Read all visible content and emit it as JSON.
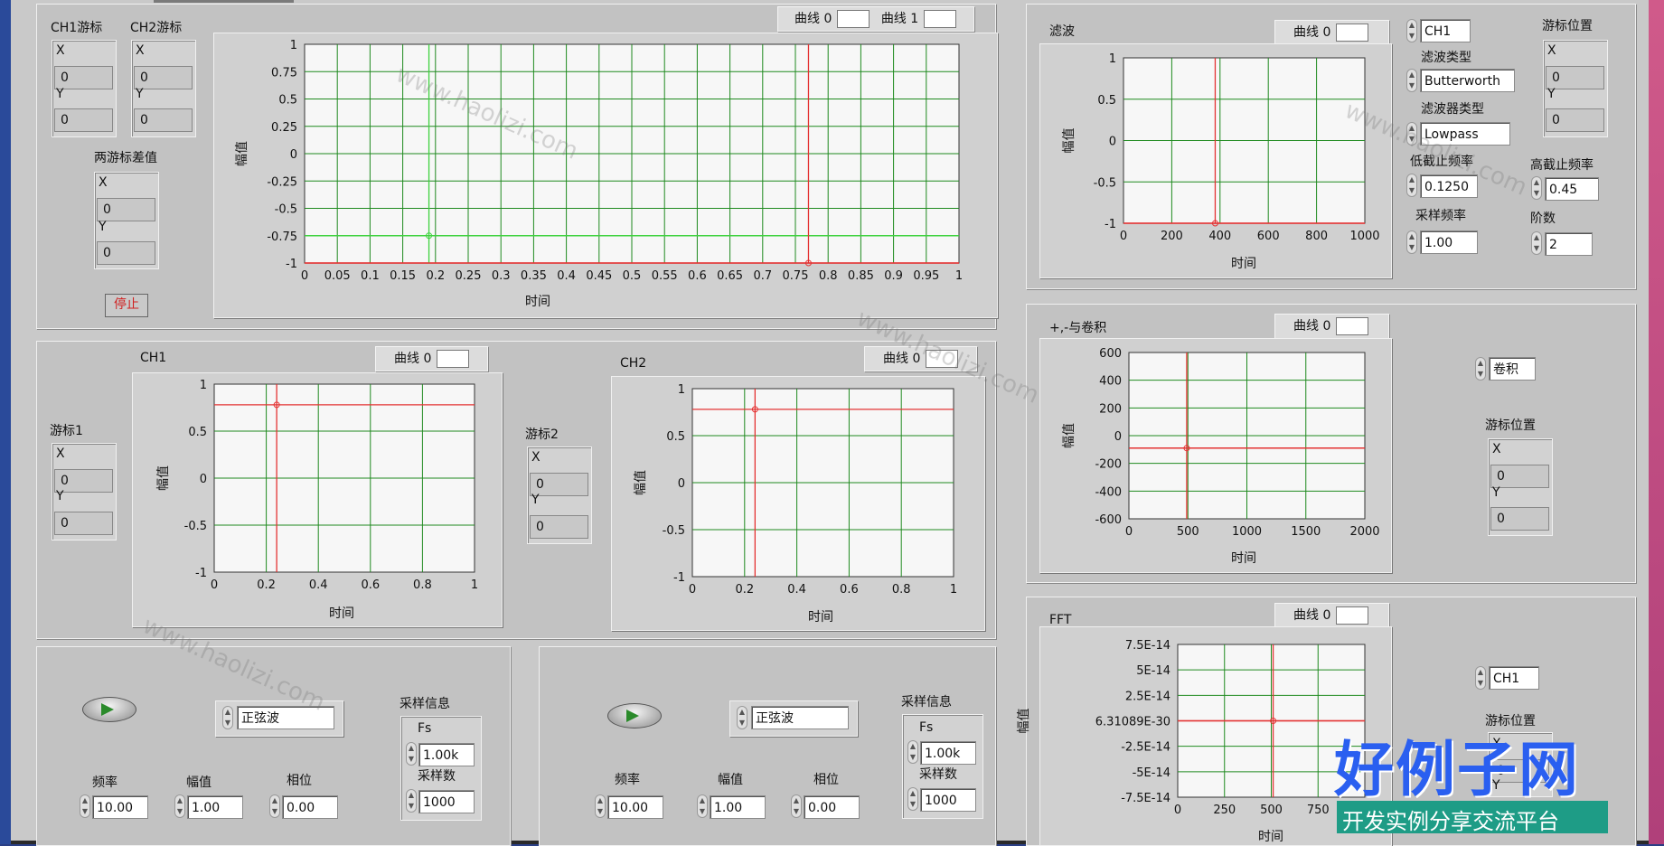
{
  "cursor_panel": {
    "ch1_cursor_label": "CH1游标",
    "ch2_cursor_label": "CH2游标",
    "diff_label": "两游标差值",
    "ch1": {
      "x_label": "X",
      "x": "0",
      "y_label": "Y",
      "y": "0"
    },
    "ch2": {
      "x_label": "X",
      "x": "0",
      "y_label": "Y",
      "y": "0"
    },
    "diff": {
      "x_label": "X",
      "x": "0",
      "y_label": "Y",
      "y": "0"
    },
    "stop_label": "停止"
  },
  "legends": {
    "curve0": "曲线 0",
    "curve1": "曲线 1"
  },
  "axis_text": {
    "amplitude": "幅值",
    "time": "时间"
  },
  "colors": {
    "grid": "#1f8a1f",
    "cursor_red": "#e43333",
    "cursor_green": "#3fd23f",
    "plot_bg": "#f7f7f7",
    "panel": "#c4c4c4",
    "chart_frame": "#d0d0d0",
    "accent_blue": "#2a5ff0",
    "dark_blue": "#2a3f86",
    "watermark_teal": "#1e9c86"
  },
  "ch1_ch2": {
    "ch1_title": "CH1",
    "ch2_title": "CH2",
    "cursor1_label": "游标1",
    "cursor2_label": "游标2",
    "cursor1": {
      "x_label": "X",
      "x": "0",
      "y_label": "Y",
      "y": "0"
    },
    "cursor2": {
      "x_label": "X",
      "x": "0",
      "y_label": "Y",
      "y": "0"
    }
  },
  "gen1": {
    "wave": "正弦波",
    "sample_info": "采样信息",
    "fs_label": "Fs",
    "fs": "1.00k",
    "n_label": "采样数",
    "n": "1000",
    "freq_label": "频率",
    "freq": "10.00",
    "amp_label": "幅值",
    "amp": "1.00",
    "phase_label": "相位",
    "phase": "0.00",
    "power_icon": "power-button-icon"
  },
  "gen2": {
    "wave": "正弦波",
    "sample_info": "采样信息",
    "fs_label": "Fs",
    "fs": "1.00k",
    "n_label": "采样数",
    "n": "1000",
    "freq_label": "频率",
    "freq": "10.00",
    "amp_label": "幅值",
    "amp": "1.00",
    "phase_label": "相位",
    "phase": "0.00",
    "power_icon": "power-button-icon"
  },
  "filter": {
    "title": "滤波",
    "channel": "CH1",
    "type_label": "滤波类型",
    "type": "Butterworth",
    "ftype_label": "滤波器类型",
    "ftype": "Lowpass",
    "low_label": "低截止频率",
    "low": "0.1250",
    "high_label": "高截止频率",
    "high": "0.45",
    "fs_label": "采样频率",
    "fs": "1.00",
    "order_label": "阶数",
    "order": "2",
    "cursor_label": "游标位置",
    "cursor": {
      "x_label": "X",
      "x": "0",
      "y_label": "Y",
      "y": "0"
    }
  },
  "conv": {
    "title": "+,-与卷积",
    "op": "卷积",
    "cursor_label": "游标位置",
    "cursor": {
      "x_label": "X",
      "x": "0",
      "y_label": "Y",
      "y": "0"
    }
  },
  "fft": {
    "title": "FFT",
    "channel": "CH1",
    "cursor_label": "游标位置",
    "cursor": {
      "x_label": "X",
      "x": "0",
      "y_label": "Y"
    }
  },
  "watermark": {
    "logo_text": "好例子网",
    "banner": "开发实例分享交流平台",
    "url": "www.haolizi.com"
  },
  "chart_data": [
    {
      "name": "main",
      "type": "line",
      "xlabel": "时间",
      "ylabel": "幅值",
      "xlim": [
        0,
        1
      ],
      "ylim": [
        -1,
        1
      ],
      "xticks": [
        "0",
        "0.05",
        "0.1",
        "0.15",
        "0.2",
        "0.25",
        "0.3",
        "0.35",
        "0.4",
        "0.45",
        "0.5",
        "0.55",
        "0.6",
        "0.65",
        "0.7",
        "0.75",
        "0.8",
        "0.85",
        "0.9",
        "0.95",
        "1"
      ],
      "yticks": [
        "1",
        "0.75",
        "0.5",
        "0.25",
        "0",
        "-0.25",
        "-0.5",
        "-0.75",
        "-1"
      ],
      "series": [
        {
          "name": "曲线 0",
          "x": [
            0,
            1
          ],
          "y": [
            -1,
            -1
          ]
        },
        {
          "name": "曲线 1",
          "x": [
            0,
            1
          ],
          "y": [
            -0.75,
            -0.75
          ]
        }
      ],
      "cursors": [
        {
          "x": 0.19,
          "y": -0.75,
          "color": "green"
        },
        {
          "x": 0.77,
          "y": -1,
          "color": "red"
        }
      ],
      "grid": true,
      "legend": "top-right"
    },
    {
      "name": "ch1",
      "type": "line",
      "xlabel": "时间",
      "ylabel": "幅值",
      "xlim": [
        0,
        1
      ],
      "ylim": [
        -1,
        1
      ],
      "xticks": [
        "0",
        "0.2",
        "0.4",
        "0.6",
        "0.8",
        "1"
      ],
      "yticks": [
        "1",
        "0.5",
        "0",
        "-0.5",
        "-1"
      ],
      "series": [
        {
          "name": "曲线 0",
          "x": [],
          "y": []
        }
      ],
      "cursors": [
        {
          "x": 0.24,
          "y": 0.78,
          "color": "red"
        }
      ],
      "grid": true,
      "legend": "top-right"
    },
    {
      "name": "ch2",
      "type": "line",
      "xlabel": "时间",
      "ylabel": "幅值",
      "xlim": [
        0,
        1
      ],
      "ylim": [
        -1,
        1
      ],
      "xticks": [
        "0",
        "0.2",
        "0.4",
        "0.6",
        "0.8",
        "1"
      ],
      "yticks": [
        "1",
        "0.5",
        "0",
        "-0.5",
        "-1"
      ],
      "series": [
        {
          "name": "曲线 0",
          "x": [],
          "y": []
        }
      ],
      "cursors": [
        {
          "x": 0.24,
          "y": 0.78,
          "color": "red"
        }
      ],
      "grid": true,
      "legend": "top-right"
    },
    {
      "name": "filter",
      "type": "line",
      "xlabel": "时间",
      "ylabel": "幅值",
      "xlim": [
        0,
        1000
      ],
      "ylim": [
        -1,
        1
      ],
      "xticks": [
        "0",
        "200",
        "400",
        "600",
        "800",
        "1000"
      ],
      "yticks": [
        "1",
        "0.5",
        "0",
        "-0.5",
        "-1"
      ],
      "series": [
        {
          "name": "曲线 0",
          "x": [
            0,
            1000
          ],
          "y": [
            -1,
            -1
          ]
        }
      ],
      "cursors": [
        {
          "x": 380,
          "y": -1,
          "color": "red"
        }
      ],
      "grid": true,
      "legend": "top-right"
    },
    {
      "name": "conv",
      "type": "line",
      "xlabel": "时间",
      "ylabel": "幅值",
      "xlim": [
        0,
        2000
      ],
      "ylim": [
        -600,
        600
      ],
      "xticks": [
        "0",
        "500",
        "1000",
        "1500",
        "2000"
      ],
      "yticks": [
        "600",
        "400",
        "200",
        "0",
        "-200",
        "-400",
        "-600"
      ],
      "series": [
        {
          "name": "曲线 0",
          "x": [
            0,
            2000
          ],
          "y": [
            -90,
            -90
          ]
        }
      ],
      "cursors": [
        {
          "x": 490,
          "y": -90,
          "color": "red"
        }
      ],
      "grid": true,
      "legend": "top-right"
    },
    {
      "name": "fft",
      "type": "line",
      "xlabel": "时间",
      "ylabel": "幅值",
      "xlim": [
        0,
        1000
      ],
      "ylim": [
        -7.5e-14,
        7.5e-14
      ],
      "xticks": [
        "0",
        "250",
        "500",
        "750"
      ],
      "yticks": [
        "7.5E-14",
        "5E-14",
        "2.5E-14",
        "6.31089E-30",
        "-2.5E-14",
        "-5E-14",
        "-7.5E-14"
      ],
      "series": [
        {
          "name": "曲线 0",
          "x": [
            0,
            1000
          ],
          "y": [
            0,
            0
          ]
        }
      ],
      "cursors": [
        {
          "x": 510,
          "y": 0,
          "color": "red"
        }
      ],
      "grid": true,
      "legend": "top-right"
    }
  ]
}
